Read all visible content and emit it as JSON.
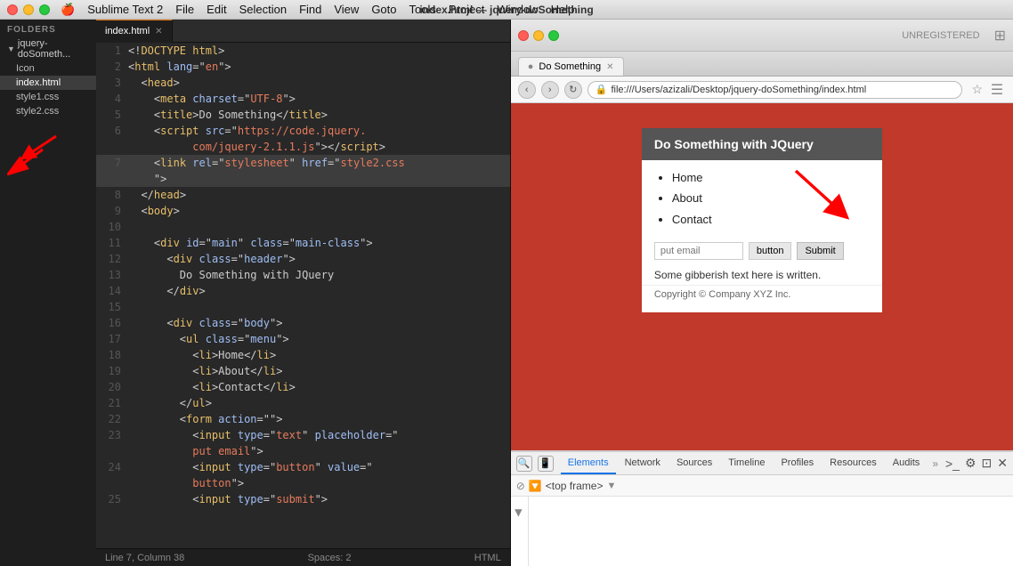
{
  "os": {
    "title": "Sublime Text 2",
    "app_title": "index.html — jquery-doSomething",
    "menu_items": [
      "File",
      "Edit",
      "Selection",
      "Find",
      "View",
      "Goto",
      "Tools",
      "Project",
      "Window",
      "Help"
    ]
  },
  "sidebar": {
    "folders_label": "FOLDERS",
    "folder_name": "jquery-doSometh...",
    "items": [
      "Icon",
      "index.html",
      "style1.css",
      "style2.css"
    ]
  },
  "editor": {
    "tab_label": "index.html",
    "status": "Line 7, Column 38",
    "spaces": "Spaces: 2",
    "syntax": "HTML"
  },
  "browser": {
    "title": "Do Something",
    "url": "file:///Users/azizali/Desktop/jquery-doSomething/index.html",
    "preview_header": "Do Something with JQuery",
    "menu_items": [
      "Home",
      "About",
      "Contact"
    ],
    "input_placeholder": "put email",
    "button_label": "button",
    "submit_label": "Submit",
    "body_text": "Some gibberish text here is written.",
    "footer_text": "Copyright © Company XYZ Inc."
  },
  "devtools": {
    "tabs": [
      "Elements",
      "Network",
      "Sources",
      "Timeline",
      "Profiles",
      "Resources",
      "Audits"
    ],
    "frame_text": "<top frame>",
    "search_placeholder": ""
  }
}
